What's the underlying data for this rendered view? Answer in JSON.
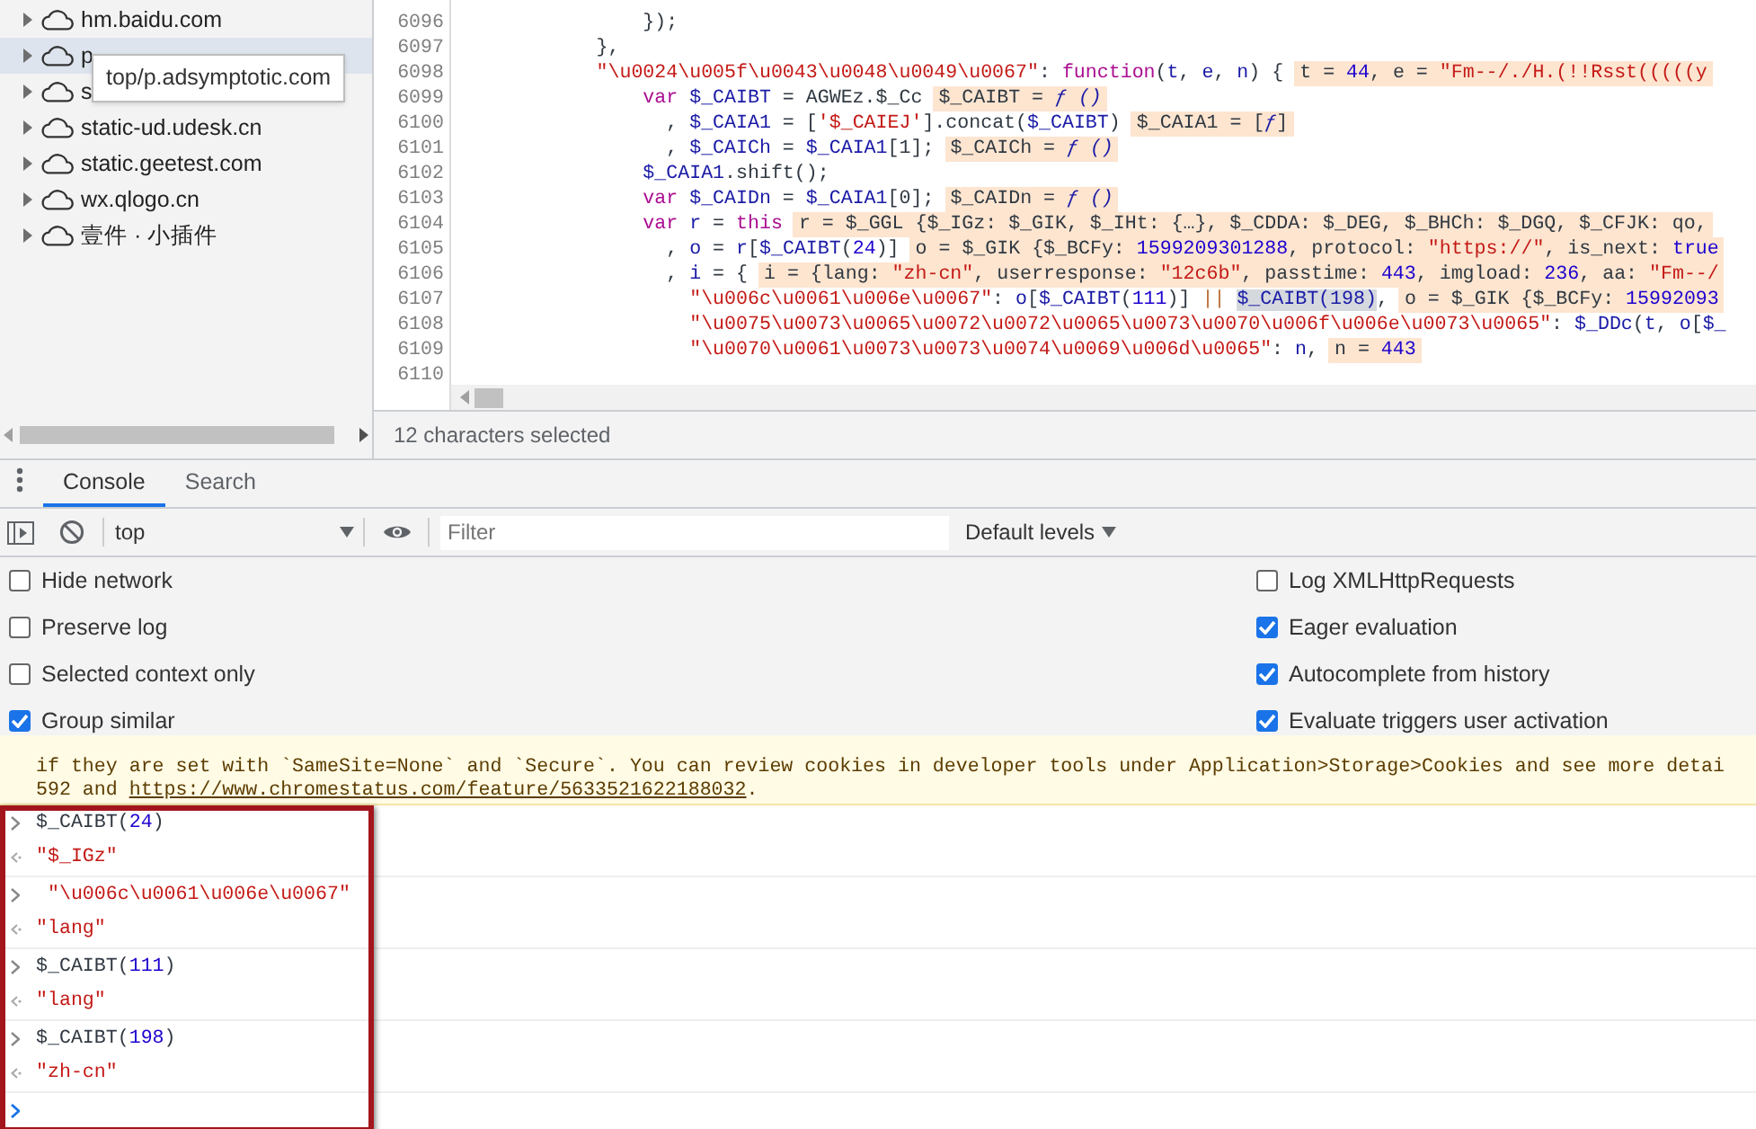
{
  "sources_tree": {
    "items": [
      {
        "label": "hm.baidu.com",
        "selected": false
      },
      {
        "label": "p",
        "selected": true
      },
      {
        "label": "s",
        "selected": false
      },
      {
        "label": "static-ud.udesk.cn",
        "selected": false
      },
      {
        "label": "static.geetest.com",
        "selected": false
      },
      {
        "label": "wx.qlogo.cn",
        "selected": false
      },
      {
        "label": "壹件 · 小插件",
        "selected": false
      }
    ]
  },
  "tooltip": "top/p.adsymptotic.com",
  "editor": {
    "lines": [
      {
        "number": "6096",
        "code": [
          {
            "kind": "plain",
            "text": "                });"
          }
        ]
      },
      {
        "number": "6097",
        "code": [
          {
            "kind": "plain",
            "text": "            },"
          }
        ]
      },
      {
        "number": "6098",
        "code": [
          {
            "kind": "str",
            "text": "            \"\\u0024\\u005f\\u0043\\u0048\\u0049\\u0067\""
          },
          {
            "kind": "plain",
            "text": ": "
          },
          {
            "kind": "kw",
            "text": "function"
          },
          {
            "kind": "plain",
            "text": "("
          },
          {
            "kind": "var",
            "text": "t"
          },
          {
            "kind": "plain",
            "text": ", "
          },
          {
            "kind": "var",
            "text": "e"
          },
          {
            "kind": "plain",
            "text": ", "
          },
          {
            "kind": "var",
            "text": "n"
          },
          {
            "kind": "plain",
            "text": ") {"
          }
        ],
        "hint": [
          {
            "kind": "plain",
            "text": "t = "
          },
          {
            "kind": "num",
            "text": "44"
          },
          {
            "kind": "plain",
            "text": ", e = "
          },
          {
            "kind": "str",
            "text": "\"Fm--/./H.(!!Rsst(((((y"
          }
        ]
      },
      {
        "number": "6099",
        "code": [
          {
            "kind": "kw",
            "text": "                var "
          },
          {
            "kind": "var",
            "text": "$_CAIBT"
          },
          {
            "kind": "plain",
            "text": " = AGWEz.$_Cc"
          }
        ],
        "hint": [
          {
            "kind": "plain",
            "text": "$_CAIBT = "
          },
          {
            "kind": "fn",
            "text": "ƒ ()"
          }
        ]
      },
      {
        "number": "6100",
        "code": [
          {
            "kind": "plain",
            "text": "                  , "
          },
          {
            "kind": "var",
            "text": "$_CAIA1"
          },
          {
            "kind": "plain",
            "text": " = ["
          },
          {
            "kind": "str",
            "text": "'$_CAIEJ'"
          },
          {
            "kind": "plain",
            "text": "].concat("
          },
          {
            "kind": "var",
            "text": "$_CAIBT"
          },
          {
            "kind": "plain",
            "text": ")"
          }
        ],
        "hint": [
          {
            "kind": "plain",
            "text": "$_CAIA1 = ["
          },
          {
            "kind": "fn",
            "text": "ƒ"
          },
          {
            "kind": "plain",
            "text": "]"
          }
        ]
      },
      {
        "number": "6101",
        "code": [
          {
            "kind": "plain",
            "text": "                  , "
          },
          {
            "kind": "var",
            "text": "$_CAICh"
          },
          {
            "kind": "plain",
            "text": " = "
          },
          {
            "kind": "var",
            "text": "$_CAIA1"
          },
          {
            "kind": "plain",
            "text": "[1];"
          }
        ],
        "hint": [
          {
            "kind": "plain",
            "text": "$_CAICh = "
          },
          {
            "kind": "fn",
            "text": "ƒ ()"
          }
        ]
      },
      {
        "number": "6102",
        "code": [
          {
            "kind": "var",
            "text": "                $_CAIA1"
          },
          {
            "kind": "plain",
            "text": ".shift();"
          }
        ]
      },
      {
        "number": "6103",
        "code": [
          {
            "kind": "kw",
            "text": "                var "
          },
          {
            "kind": "var",
            "text": "$_CAIDn"
          },
          {
            "kind": "plain",
            "text": " = "
          },
          {
            "kind": "var",
            "text": "$_CAIA1"
          },
          {
            "kind": "plain",
            "text": "[0];"
          }
        ],
        "hint": [
          {
            "kind": "plain",
            "text": "$_CAIDn = "
          },
          {
            "kind": "fn",
            "text": "ƒ ()"
          }
        ]
      },
      {
        "number": "6104",
        "code": [
          {
            "kind": "kw",
            "text": "                var "
          },
          {
            "kind": "var",
            "text": "r"
          },
          {
            "kind": "plain",
            "text": " = "
          },
          {
            "kind": "kw",
            "text": "this"
          }
        ],
        "hint": [
          {
            "kind": "plain",
            "text": "r = $_GGL {$_IGz: $_GIK, $_IHt: {…}, $_CDDA: $_DEG, $_BHCh: $_DGQ, $_CFJK: qo,"
          }
        ]
      },
      {
        "number": "6105",
        "code": [
          {
            "kind": "plain",
            "text": "                  , "
          },
          {
            "kind": "var",
            "text": "o"
          },
          {
            "kind": "plain",
            "text": " = "
          },
          {
            "kind": "var",
            "text": "r"
          },
          {
            "kind": "plain",
            "text": "["
          },
          {
            "kind": "var",
            "text": "$_CAIBT"
          },
          {
            "kind": "plain",
            "text": "("
          },
          {
            "kind": "num",
            "text": "24"
          },
          {
            "kind": "plain",
            "text": ")]"
          }
        ],
        "hint": [
          {
            "kind": "plain",
            "text": "o = $_GIK {$_BCFy: "
          },
          {
            "kind": "num",
            "text": "1599209301288"
          },
          {
            "kind": "plain",
            "text": ", protocol: "
          },
          {
            "kind": "str",
            "text": "\"https://\""
          },
          {
            "kind": "plain",
            "text": ", is_next: "
          },
          {
            "kind": "num",
            "text": "true"
          }
        ]
      },
      {
        "number": "6106",
        "code": [
          {
            "kind": "plain",
            "text": "                  , "
          },
          {
            "kind": "var",
            "text": "i"
          },
          {
            "kind": "plain",
            "text": " = {"
          }
        ],
        "hint": [
          {
            "kind": "plain",
            "text": "i = {lang: "
          },
          {
            "kind": "str",
            "text": "\"zh-cn\""
          },
          {
            "kind": "plain",
            "text": ", userresponse: "
          },
          {
            "kind": "str",
            "text": "\"12c6b\""
          },
          {
            "kind": "plain",
            "text": ", passtime: "
          },
          {
            "kind": "num",
            "text": "443"
          },
          {
            "kind": "plain",
            "text": ", imgload: "
          },
          {
            "kind": "num",
            "text": "236"
          },
          {
            "kind": "plain",
            "text": ", aa: "
          },
          {
            "kind": "str",
            "text": "\"Fm--/"
          }
        ]
      },
      {
        "number": "6107",
        "code": [
          {
            "kind": "str",
            "text": "                    \"\\u006c\\u0061\\u006e\\u0067\""
          },
          {
            "kind": "plain",
            "text": ": "
          },
          {
            "kind": "var",
            "text": "o"
          },
          {
            "kind": "plain",
            "text": "["
          },
          {
            "kind": "var",
            "text": "$_CAIBT"
          },
          {
            "kind": "plain",
            "text": "("
          },
          {
            "kind": "num",
            "text": "111"
          },
          {
            "kind": "plain",
            "text": ")] "
          },
          {
            "kind": "op",
            "text": "|| "
          },
          {
            "kind": "sel",
            "text": "$_CAIBT(198)"
          },
          {
            "kind": "plain",
            "text": ","
          }
        ],
        "hint": [
          {
            "kind": "plain",
            "text": "o = $_GIK {$_BCFy: "
          },
          {
            "kind": "num",
            "text": "15992093"
          }
        ]
      },
      {
        "number": "6108",
        "code": [
          {
            "kind": "str",
            "text": "                    \"\\u0075\\u0073\\u0065\\u0072\\u0072\\u0065\\u0073\\u0070\\u006f\\u006e\\u0073\\u0065\""
          },
          {
            "kind": "plain",
            "text": ": "
          },
          {
            "kind": "var",
            "text": "$_DDc"
          },
          {
            "kind": "plain",
            "text": "("
          },
          {
            "kind": "var",
            "text": "t"
          },
          {
            "kind": "plain",
            "text": ", "
          },
          {
            "kind": "var",
            "text": "o"
          },
          {
            "kind": "plain",
            "text": "["
          },
          {
            "kind": "var",
            "text": "$_"
          }
        ]
      },
      {
        "number": "6109",
        "code": [
          {
            "kind": "str",
            "text": "                    \"\\u0070\\u0061\\u0073\\u0073\\u0074\\u0069\\u006d\\u0065\""
          },
          {
            "kind": "plain",
            "text": ": "
          },
          {
            "kind": "var",
            "text": "n"
          },
          {
            "kind": "plain",
            "text": ","
          }
        ],
        "hint": [
          {
            "kind": "plain",
            "text": "n = "
          },
          {
            "kind": "num",
            "text": "443"
          }
        ]
      },
      {
        "number": "6110"
      }
    ],
    "status": "12 characters selected"
  },
  "drawer": {
    "tabs": [
      {
        "label": "Console",
        "selected": true
      },
      {
        "label": "Search",
        "selected": false
      }
    ],
    "context": "top",
    "filter_placeholder": "Filter",
    "levels": "Default levels",
    "settings_left": [
      {
        "label": "Hide network",
        "checked": false
      },
      {
        "label": "Preserve log",
        "checked": false
      },
      {
        "label": "Selected context only",
        "checked": false
      },
      {
        "label": "Group similar",
        "checked": true
      }
    ],
    "settings_right": [
      {
        "label": "Log XMLHttpRequests",
        "checked": false
      },
      {
        "label": "Eager evaluation",
        "checked": true
      },
      {
        "label": "Autocomplete from history",
        "checked": true
      },
      {
        "label": "Evaluate triggers user activation",
        "checked": true
      }
    ]
  },
  "console": {
    "warning": {
      "line_1": "if they are set with `SameSite=None` and `Secure`. You can review cookies in developer tools under Application>Storage>Cookies and see more detai",
      "line_2_start": "592 and ",
      "link": "https://www.chromestatus.com/feature/5633521622188032",
      "line_2_end": "."
    },
    "entries": [
      {
        "input": [
          {
            "kind": "plain",
            "text": "$_CAIBT("
          },
          {
            "kind": "num",
            "text": "24"
          },
          {
            "kind": "plain",
            "text": ")"
          }
        ],
        "output": [
          {
            "kind": "str",
            "text": "\"$_IGz\""
          }
        ]
      },
      {
        "input": [
          {
            "kind": "str",
            "text": " \"\\u006c\\u0061\\u006e\\u0067\""
          }
        ],
        "output": [
          {
            "kind": "str",
            "text": "\"lang\""
          }
        ]
      },
      {
        "input": [
          {
            "kind": "plain",
            "text": "$_CAIBT("
          },
          {
            "kind": "num",
            "text": "111"
          },
          {
            "kind": "plain",
            "text": ")"
          }
        ],
        "output": [
          {
            "kind": "str",
            "text": "\"lang\""
          }
        ]
      },
      {
        "input": [
          {
            "kind": "plain",
            "text": "$_CAIBT("
          },
          {
            "kind": "num",
            "text": "198"
          },
          {
            "kind": "plain",
            "text": ")"
          }
        ],
        "output": [
          {
            "kind": "str",
            "text": "\"zh-cn\""
          }
        ]
      }
    ]
  }
}
